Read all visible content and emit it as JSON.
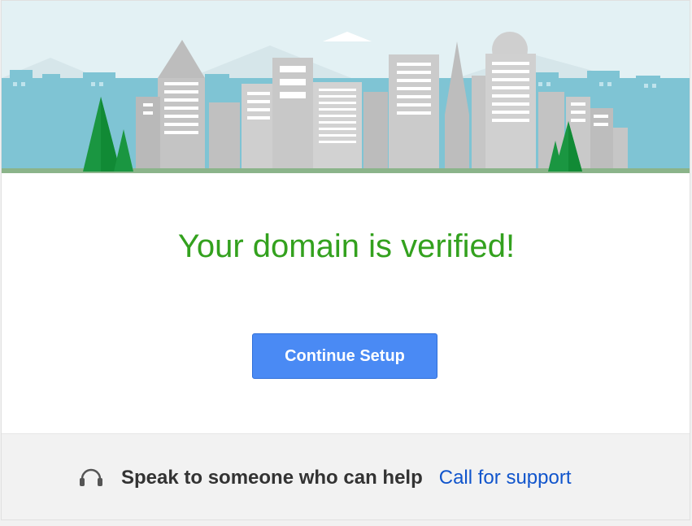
{
  "banner": {
    "scene": "city-skyline-illustration"
  },
  "main": {
    "title": "Your domain is verified!"
  },
  "actions": {
    "continue_label": "Continue Setup"
  },
  "footer": {
    "icon": "headset-icon",
    "help_text": "Speak to someone who can help",
    "link_label": "Call for support"
  },
  "colors": {
    "title_green": "#33a11e",
    "button_blue": "#4a8af4",
    "link_blue": "#1155cc",
    "sky": "#e3f1f4"
  }
}
